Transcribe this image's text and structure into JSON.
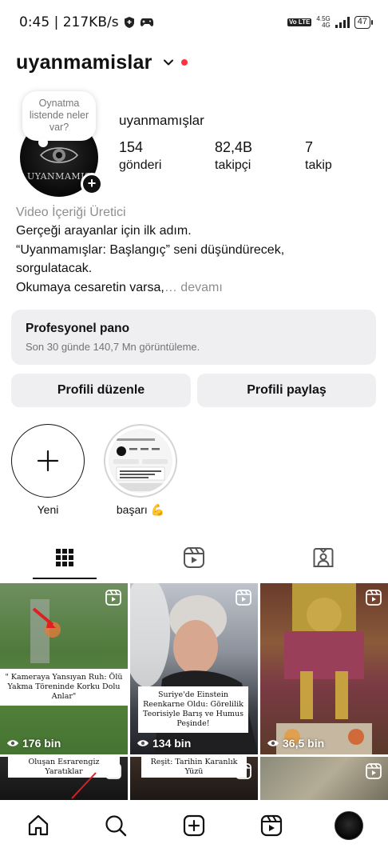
{
  "status_bar": {
    "time": "0:45",
    "speed": "217KB/s",
    "volte": "Vo LTE",
    "network": "4.5G",
    "network_sub": "4G",
    "battery": "47"
  },
  "header": {
    "username": "uyanmamislar",
    "dot_color": "#ff3040"
  },
  "profile": {
    "note": "Oynatma listende neler var?",
    "avatar_brand": "UYANMAMIŞ",
    "display_name": "uyanmamışlar",
    "stats": [
      {
        "num": "154",
        "label": "gönderi"
      },
      {
        "num": "82,4B",
        "label": "takipçi"
      },
      {
        "num": "7",
        "label": "takip"
      }
    ]
  },
  "bio": {
    "category": "Video İçeriği Üretici",
    "lines": [
      "Gerçeği arayanlar için ilk adım.",
      "“Uyanmamışlar: Başlangıç” seni düşündürecek,",
      "sorgulatacak.",
      "Okumaya cesaretin varsa,"
    ],
    "more": "… devamı"
  },
  "dashboard": {
    "title": "Profesyonel pano",
    "subtitle": "Son 30 günde 140,7 Mn görüntüleme."
  },
  "buttons": {
    "edit": "Profili düzenle",
    "share": "Profili paylaş"
  },
  "highlights": [
    {
      "label": "Yeni",
      "icon": "plus-icon"
    },
    {
      "label": "başarı 💪",
      "icon": "story-thumbnail"
    }
  ],
  "tabs": [
    {
      "icon": "grid-icon",
      "active": true
    },
    {
      "icon": "reels-icon",
      "active": false
    },
    {
      "icon": "tagged-icon",
      "active": false
    }
  ],
  "posts": [
    {
      "caption": "\" Kameraya Yansıyan Ruh: Ölü Yakma Töreninde Korku Dolu Anlar\"",
      "views": "176 bin"
    },
    {
      "caption": "Suriye'de Einstein Reenkarne Oldu: Görelilik Teorisiyle Barış ve Humus Peşinde!",
      "views": "134 bin"
    },
    {
      "caption": "",
      "views": "36,5 bin"
    },
    {
      "caption": "Oluşan Esrarengiz Yaratıklar",
      "views": ""
    },
    {
      "caption": "Reşit: Tarihin Karanlık Yüzü",
      "views": ""
    },
    {
      "caption": "",
      "views": ""
    }
  ],
  "bottom_nav": [
    "home-icon",
    "search-icon",
    "create-icon",
    "reels-icon",
    "profile-avatar"
  ]
}
